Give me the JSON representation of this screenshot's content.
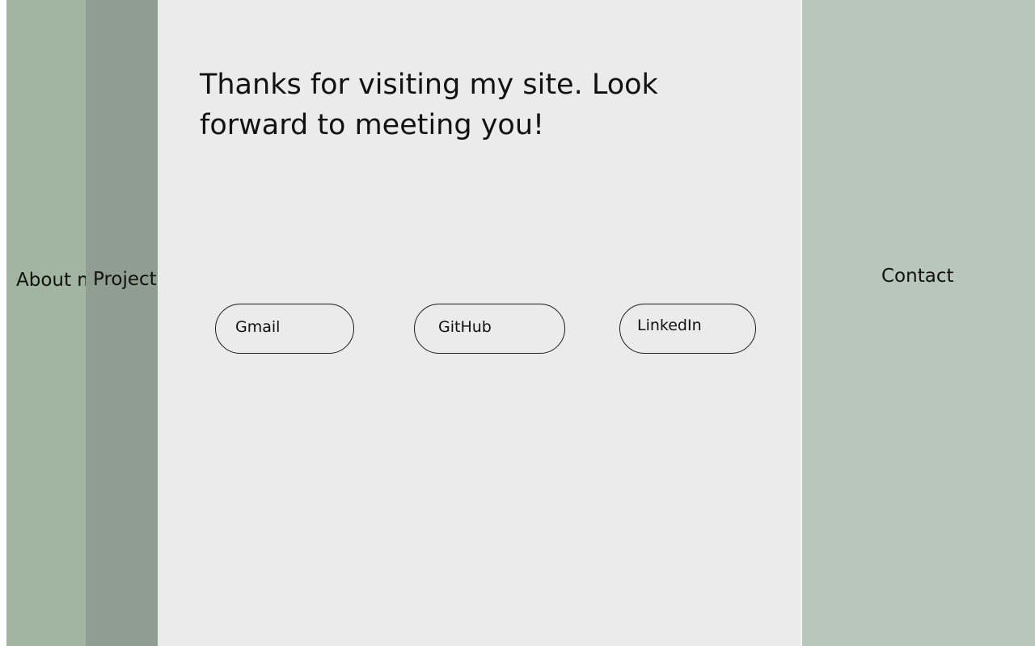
{
  "nav": {
    "about_label": "About me",
    "projects_label": "Projects",
    "contact_label": "Contact"
  },
  "content": {
    "message": "Thanks for visiting my site. Look forward to meeting you!"
  },
  "links": {
    "gmail_label": "Gmail",
    "github_label": "GitHub",
    "linkedin_label": "LinkedIn"
  },
  "colors": {
    "about_panel": "#a2b5a0",
    "projects_panel": "#8f9e90",
    "contact_panel": "#b9c6bb",
    "content_background": "#ebebeb"
  }
}
